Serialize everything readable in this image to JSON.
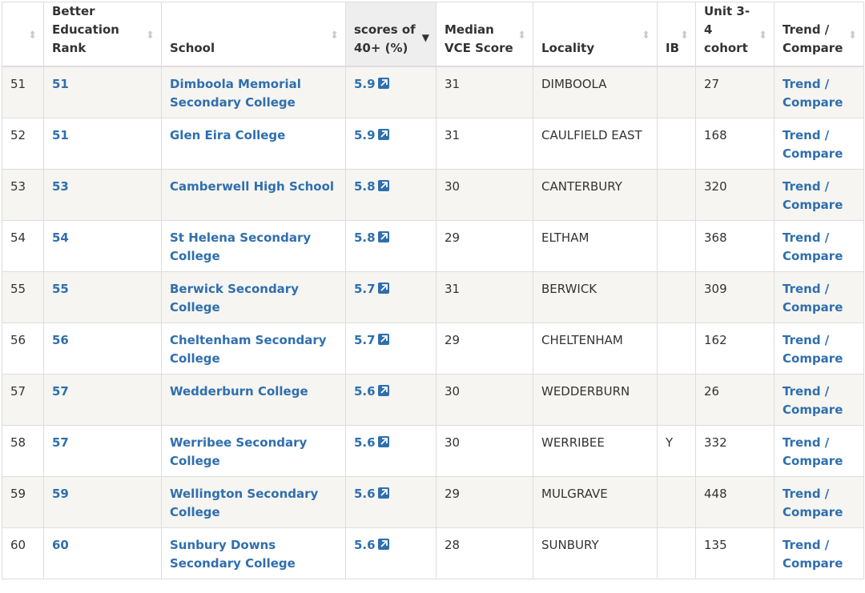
{
  "table": {
    "headers": [
      {
        "key": "row",
        "label": ""
      },
      {
        "key": "rank",
        "label": "Better Education Rank"
      },
      {
        "key": "school",
        "label": "School"
      },
      {
        "key": "score40",
        "label": "scores of 40+ (%)"
      },
      {
        "key": "median",
        "label": "Median VCE Score"
      },
      {
        "key": "locality",
        "label": "Locality"
      },
      {
        "key": "ib",
        "label": "IB"
      },
      {
        "key": "cohort",
        "label": "Unit 3-4 cohort"
      },
      {
        "key": "trend",
        "label": "Trend / Compare"
      }
    ],
    "sorted_column": "score40",
    "rows": [
      {
        "row": "51",
        "rank": "51",
        "school": "Dimboola Memorial Secondary College",
        "score40": "5.9",
        "median": "31",
        "locality": "DIMBOOLA",
        "ib": "",
        "cohort": "27",
        "trend": "Trend / Compare"
      },
      {
        "row": "52",
        "rank": "51",
        "school": "Glen Eira College",
        "score40": "5.9",
        "median": "31",
        "locality": "CAULFIELD EAST",
        "ib": "",
        "cohort": "168",
        "trend": "Trend / Compare"
      },
      {
        "row": "53",
        "rank": "53",
        "school": "Camberwell High School",
        "score40": "5.8",
        "median": "30",
        "locality": "CANTERBURY",
        "ib": "",
        "cohort": "320",
        "trend": "Trend / Compare"
      },
      {
        "row": "54",
        "rank": "54",
        "school": "St Helena Secondary College",
        "score40": "5.8",
        "median": "29",
        "locality": "ELTHAM",
        "ib": "",
        "cohort": "368",
        "trend": "Trend / Compare"
      },
      {
        "row": "55",
        "rank": "55",
        "school": "Berwick Secondary College",
        "score40": "5.7",
        "median": "31",
        "locality": "BERWICK",
        "ib": "",
        "cohort": "309",
        "trend": "Trend / Compare"
      },
      {
        "row": "56",
        "rank": "56",
        "school": "Cheltenham Secondary College",
        "score40": "5.7",
        "median": "29",
        "locality": "CHELTENHAM",
        "ib": "",
        "cohort": "162",
        "trend": "Trend / Compare"
      },
      {
        "row": "57",
        "rank": "57",
        "school": "Wedderburn College",
        "score40": "5.6",
        "median": "30",
        "locality": "WEDDERBURN",
        "ib": "",
        "cohort": "26",
        "trend": "Trend / Compare"
      },
      {
        "row": "58",
        "rank": "57",
        "school": "Werribee Secondary College",
        "score40": "5.6",
        "median": "30",
        "locality": "WERRIBEE",
        "ib": "Y",
        "cohort": "332",
        "trend": "Trend / Compare"
      },
      {
        "row": "59",
        "rank": "59",
        "school": "Wellington Secondary College",
        "score40": "5.6",
        "median": "29",
        "locality": "MULGRAVE",
        "ib": "",
        "cohort": "448",
        "trend": "Trend / Compare"
      },
      {
        "row": "60",
        "rank": "60",
        "school": "Sunbury Downs Secondary College",
        "score40": "5.6",
        "median": "28",
        "locality": "SUNBURY",
        "ib": "",
        "cohort": "135",
        "trend": "Trend / Compare"
      }
    ]
  },
  "colors": {
    "link": "#2f6fae",
    "row_alt": "#f6f5f1",
    "sorted_header": "#eeeeee",
    "border": "#dddddd"
  },
  "icons": {
    "sort_unsorted": "sort-both-icon",
    "sort_desc": "sort-desc-icon",
    "external": "external-link-icon"
  }
}
